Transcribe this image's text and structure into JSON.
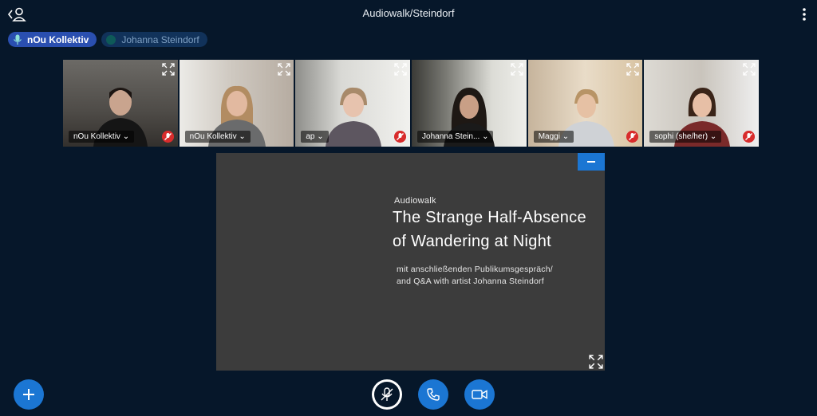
{
  "header": {
    "title": "Audiowalk/Steindorf"
  },
  "talkers": [
    {
      "name": "nOu Kollektiv",
      "state": "talking"
    },
    {
      "name": "Johanna Steindorf",
      "state": "idle"
    }
  ],
  "videos": [
    {
      "name": "nOu Kollektiv ⌄",
      "muted": true
    },
    {
      "name": "nOu Kollektiv ⌄",
      "muted": false,
      "speaking": true
    },
    {
      "name": "ap ⌄",
      "muted": true
    },
    {
      "name": "Johanna Stein... ⌄",
      "muted": false
    },
    {
      "name": "Maggi ⌄",
      "muted": true
    },
    {
      "name": "sophi (she/her) ⌄",
      "muted": true
    }
  ],
  "slide": {
    "kicker": "Audiowalk",
    "title": "The Strange Half-Absence of Wandering at Night",
    "subtitle_line1": "mit anschließenden Publikumsgespräch/",
    "subtitle_line2": "and Q&A with artist Johanna Steindorf"
  },
  "controls": {
    "actions": "plus-icon",
    "microphone": "microphone-muted-icon",
    "audio": "phone-icon",
    "camera": "video-camera-icon"
  },
  "colors": {
    "background": "#06172a",
    "accent": "#1b76d3",
    "presentation_bg": "#3c3c3c",
    "muted_badge": "#d82c2c"
  }
}
